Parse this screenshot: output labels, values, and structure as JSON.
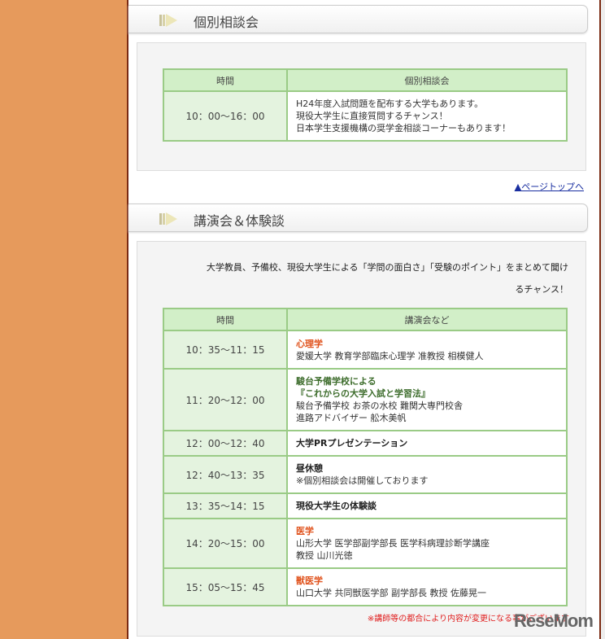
{
  "section1": {
    "title": "個別相談会",
    "table": {
      "headers": [
        "時間",
        "個別相談会"
      ],
      "rows": [
        {
          "time": "10：00〜16：00",
          "lines": [
            "H24年度入試問題を配布する大学もあります。",
            "現役大学生に直接質問するチャンス！",
            "日本学生支援機構の奨学金相談コーナーもあります！"
          ]
        }
      ]
    }
  },
  "page_top": "▲ページトップへ",
  "section2": {
    "title": "講演会＆体験談",
    "intro_1": "大学教員、予備校、現役大学生による「学問の面白さ」「受験のポイント」をまとめて聞け",
    "intro_2": "るチャンス！",
    "table": {
      "headers": [
        "時間",
        "講演会など"
      ],
      "rows": [
        {
          "time": "10：35〜11：15",
          "title": "心理学",
          "style": "orange",
          "lines": [
            "愛媛大学 教育学部臨床心理学 准教授 相模健人"
          ]
        },
        {
          "time": "11：20〜12：00",
          "title": "駿台予備学校による",
          "title2": "『これからの大学入試と学習法』",
          "style": "green",
          "lines": [
            "駿台予備学校 お茶の水校 難関大専門校舎",
            "進路アドバイザー 舩木美帆"
          ]
        },
        {
          "time": "12：00〜12：40",
          "title": "大学PRプレゼンテーション",
          "style": "bold",
          "lines": []
        },
        {
          "time": "12：40〜13：35",
          "title": "昼休憩",
          "style": "bold",
          "lines": [
            "※個別相談会は開催しております"
          ]
        },
        {
          "time": "13：35〜14：15",
          "title": "現役大学生の体験談",
          "style": "bold",
          "lines": []
        },
        {
          "time": "14：20〜15：00",
          "title": "医学",
          "style": "orange",
          "lines": [
            "山形大学 医学部副学部長 医学科病理診断学講座",
            "教授 山川光徳"
          ]
        },
        {
          "time": "15：05〜15：45",
          "title": "獣医学",
          "style": "orange",
          "lines": [
            "山口大学 共同獣医学部 副学部長 教授 佐藤晃一"
          ]
        }
      ]
    },
    "note": "※講師等の都合により内容が変更になる事がございます"
  },
  "watermark": "ReseMom"
}
